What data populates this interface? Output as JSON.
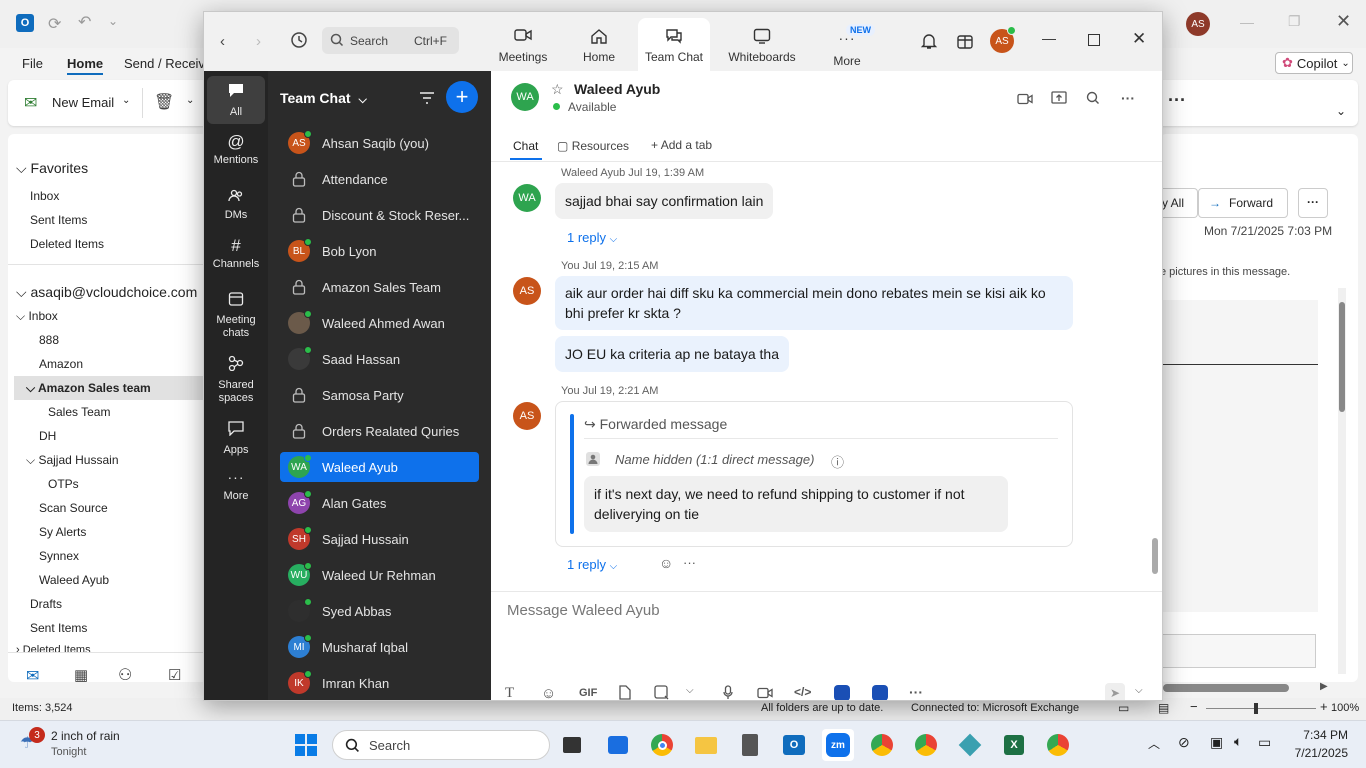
{
  "outlook": {
    "menu": [
      "File",
      "Home",
      "Send / Receive"
    ],
    "menu_display": [
      "File",
      "Home",
      "Send / Receiv"
    ],
    "new_email": "New Email",
    "copilot": "Copilot",
    "favorites": "Favorites",
    "favorites_items": [
      "Inbox",
      "Sent Items",
      "Deleted Items"
    ],
    "account": "asaqib@vcloudchoice.com",
    "folders": [
      "Inbox",
      "888",
      "Amazon",
      "Amazon Sales team",
      "Sales Team",
      "DH",
      "Sajjad Hussain",
      "OTPs",
      "Scan Source",
      "Sy Alerts",
      "Synnex",
      "Waleed Ayub",
      "Drafts",
      "Sent Items",
      "Deleted Items"
    ],
    "reply_all": "y All",
    "forward": "Forward",
    "date": "Mon 7/21/2025 7:03 PM",
    "pictures_note": "e pictures in this message.",
    "items_count": "Items: 3,524",
    "status_sync": "All folders are up to date.",
    "status_conn": "Connected to: Microsoft Exchange",
    "zoom_pct": "100%",
    "avatar": "AS"
  },
  "zoom": {
    "search_placeholder": "Search",
    "search_shortcut": "Ctrl+F",
    "nav": [
      {
        "label": "Meetings",
        "icon": "video-icon"
      },
      {
        "label": "Home",
        "icon": "home-icon"
      },
      {
        "label": "Team Chat",
        "icon": "chat-icon"
      },
      {
        "label": "Whiteboards",
        "icon": "whiteboard-icon"
      },
      {
        "label": "More",
        "icon": "more-icon"
      }
    ],
    "new_badge": "NEW",
    "user_avatar": "AS",
    "rail": [
      {
        "label": "All",
        "icon": "chat-bubble-icon"
      },
      {
        "label": "Mentions",
        "icon": "at-icon"
      },
      {
        "label": "DMs",
        "icon": "people-icon"
      },
      {
        "label": "Channels",
        "icon": "hash-icon"
      },
      {
        "label": "Meeting chats",
        "icon": "calendar-icon"
      },
      {
        "label": "Shared spaces",
        "icon": "shared-icon"
      },
      {
        "label": "Apps",
        "icon": "apps-icon"
      },
      {
        "label": "More",
        "icon": "ellipsis-icon"
      }
    ],
    "list_title": "Team Chat",
    "contacts": [
      {
        "name": "Ahsan Saqib (you)",
        "initials": "AS",
        "color": "#c8541a",
        "type": "person",
        "online": true
      },
      {
        "name": "Attendance",
        "type": "channel"
      },
      {
        "name": "Discount & Stock Reser...",
        "type": "channel"
      },
      {
        "name": "Bob Lyon",
        "initials": "BL",
        "color": "#c8541a",
        "type": "person",
        "online": true
      },
      {
        "name": "Amazon Sales Team",
        "type": "channel"
      },
      {
        "name": "Waleed Ahmed Awan",
        "initials": "",
        "color": "#6b5a4a",
        "type": "photo",
        "online": true
      },
      {
        "name": "Saad Hassan",
        "initials": "",
        "color": "#3a3a3a",
        "type": "photo",
        "online": true
      },
      {
        "name": "Samosa Party",
        "type": "channel"
      },
      {
        "name": "Orders Realated Quries",
        "type": "channel"
      },
      {
        "name": "Waleed Ayub",
        "initials": "WA",
        "color": "#2ea44f",
        "type": "person",
        "online": true,
        "selected": true
      },
      {
        "name": "Alan Gates",
        "initials": "AG",
        "color": "#8e44ad",
        "type": "person",
        "online": true
      },
      {
        "name": "Sajjad Hussain",
        "initials": "SH",
        "color": "#c0392b",
        "type": "person",
        "online": true
      },
      {
        "name": "Waleed Ur Rehman",
        "initials": "WU",
        "color": "#27ae60",
        "type": "person",
        "online": true
      },
      {
        "name": "Syed Abbas",
        "initials": "",
        "color": "#2e2e2e",
        "type": "photo",
        "online": true
      },
      {
        "name": "Musharaf Iqbal",
        "initials": "MI",
        "color": "#2d7fd3",
        "type": "person",
        "online": true
      },
      {
        "name": "Imran Khan",
        "initials": "IK",
        "color": "#c0392b",
        "type": "person",
        "online": true
      }
    ],
    "chat": {
      "name": "Waleed Ayub",
      "initials": "WA",
      "status": "Available",
      "tabs": [
        "Chat",
        "Resources",
        "Add a tab"
      ],
      "messages": [
        {
          "author": "Waleed Ayub",
          "time": "Jul 19, 1:39 AM",
          "text": "sajjad bhai say confirmation lain",
          "reply": "1 reply"
        },
        {
          "author": "You",
          "time": "Jul 19, 2:15 AM",
          "text": "aik aur order hai diff sku ka commercial mein dono rebates mein se kisi aik ko bhi prefer kr skta ?",
          "text2": "JO EU ka criteria ap ne bataya tha"
        },
        {
          "author": "You",
          "time": "Jul 19, 2:21 AM",
          "forwarded_label": "Forwarded message",
          "hidden": "Name hidden (1:1 direct message)",
          "text": "if it's next day, we need to refund shipping to customer if not deliverying on tie",
          "reply": "1 reply"
        }
      ],
      "composer_placeholder": "Message Waleed Ayub",
      "gif": "GIF"
    }
  },
  "taskbar": {
    "weather_badge": "3",
    "weather": "2 inch of rain",
    "weather_sub": "Tonight",
    "search": "Search",
    "time": "7:34 PM",
    "date": "7/21/2025"
  }
}
